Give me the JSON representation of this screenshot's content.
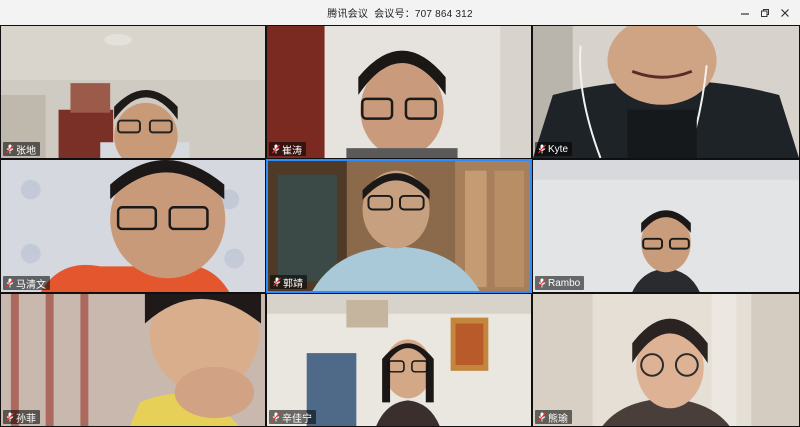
{
  "window": {
    "app_name": "腾讯会议",
    "meeting_label": "会议号：707 864 312",
    "controls": {
      "minimize": "minimize-icon",
      "restore": "restore-icon",
      "close": "close-icon"
    }
  },
  "participants": [
    {
      "name": "张地"
    },
    {
      "name": "崔涛"
    },
    {
      "name": "Kyte"
    },
    {
      "name": "马清文"
    },
    {
      "name": "郭靖",
      "active": true
    },
    {
      "name": "Rambo"
    },
    {
      "name": "孙菲"
    },
    {
      "name": "辛佳宁"
    },
    {
      "name": "熊瑜"
    }
  ],
  "colors": {
    "active_border": "#2f8cff",
    "titlebar_bg": "#f3f3f3"
  }
}
